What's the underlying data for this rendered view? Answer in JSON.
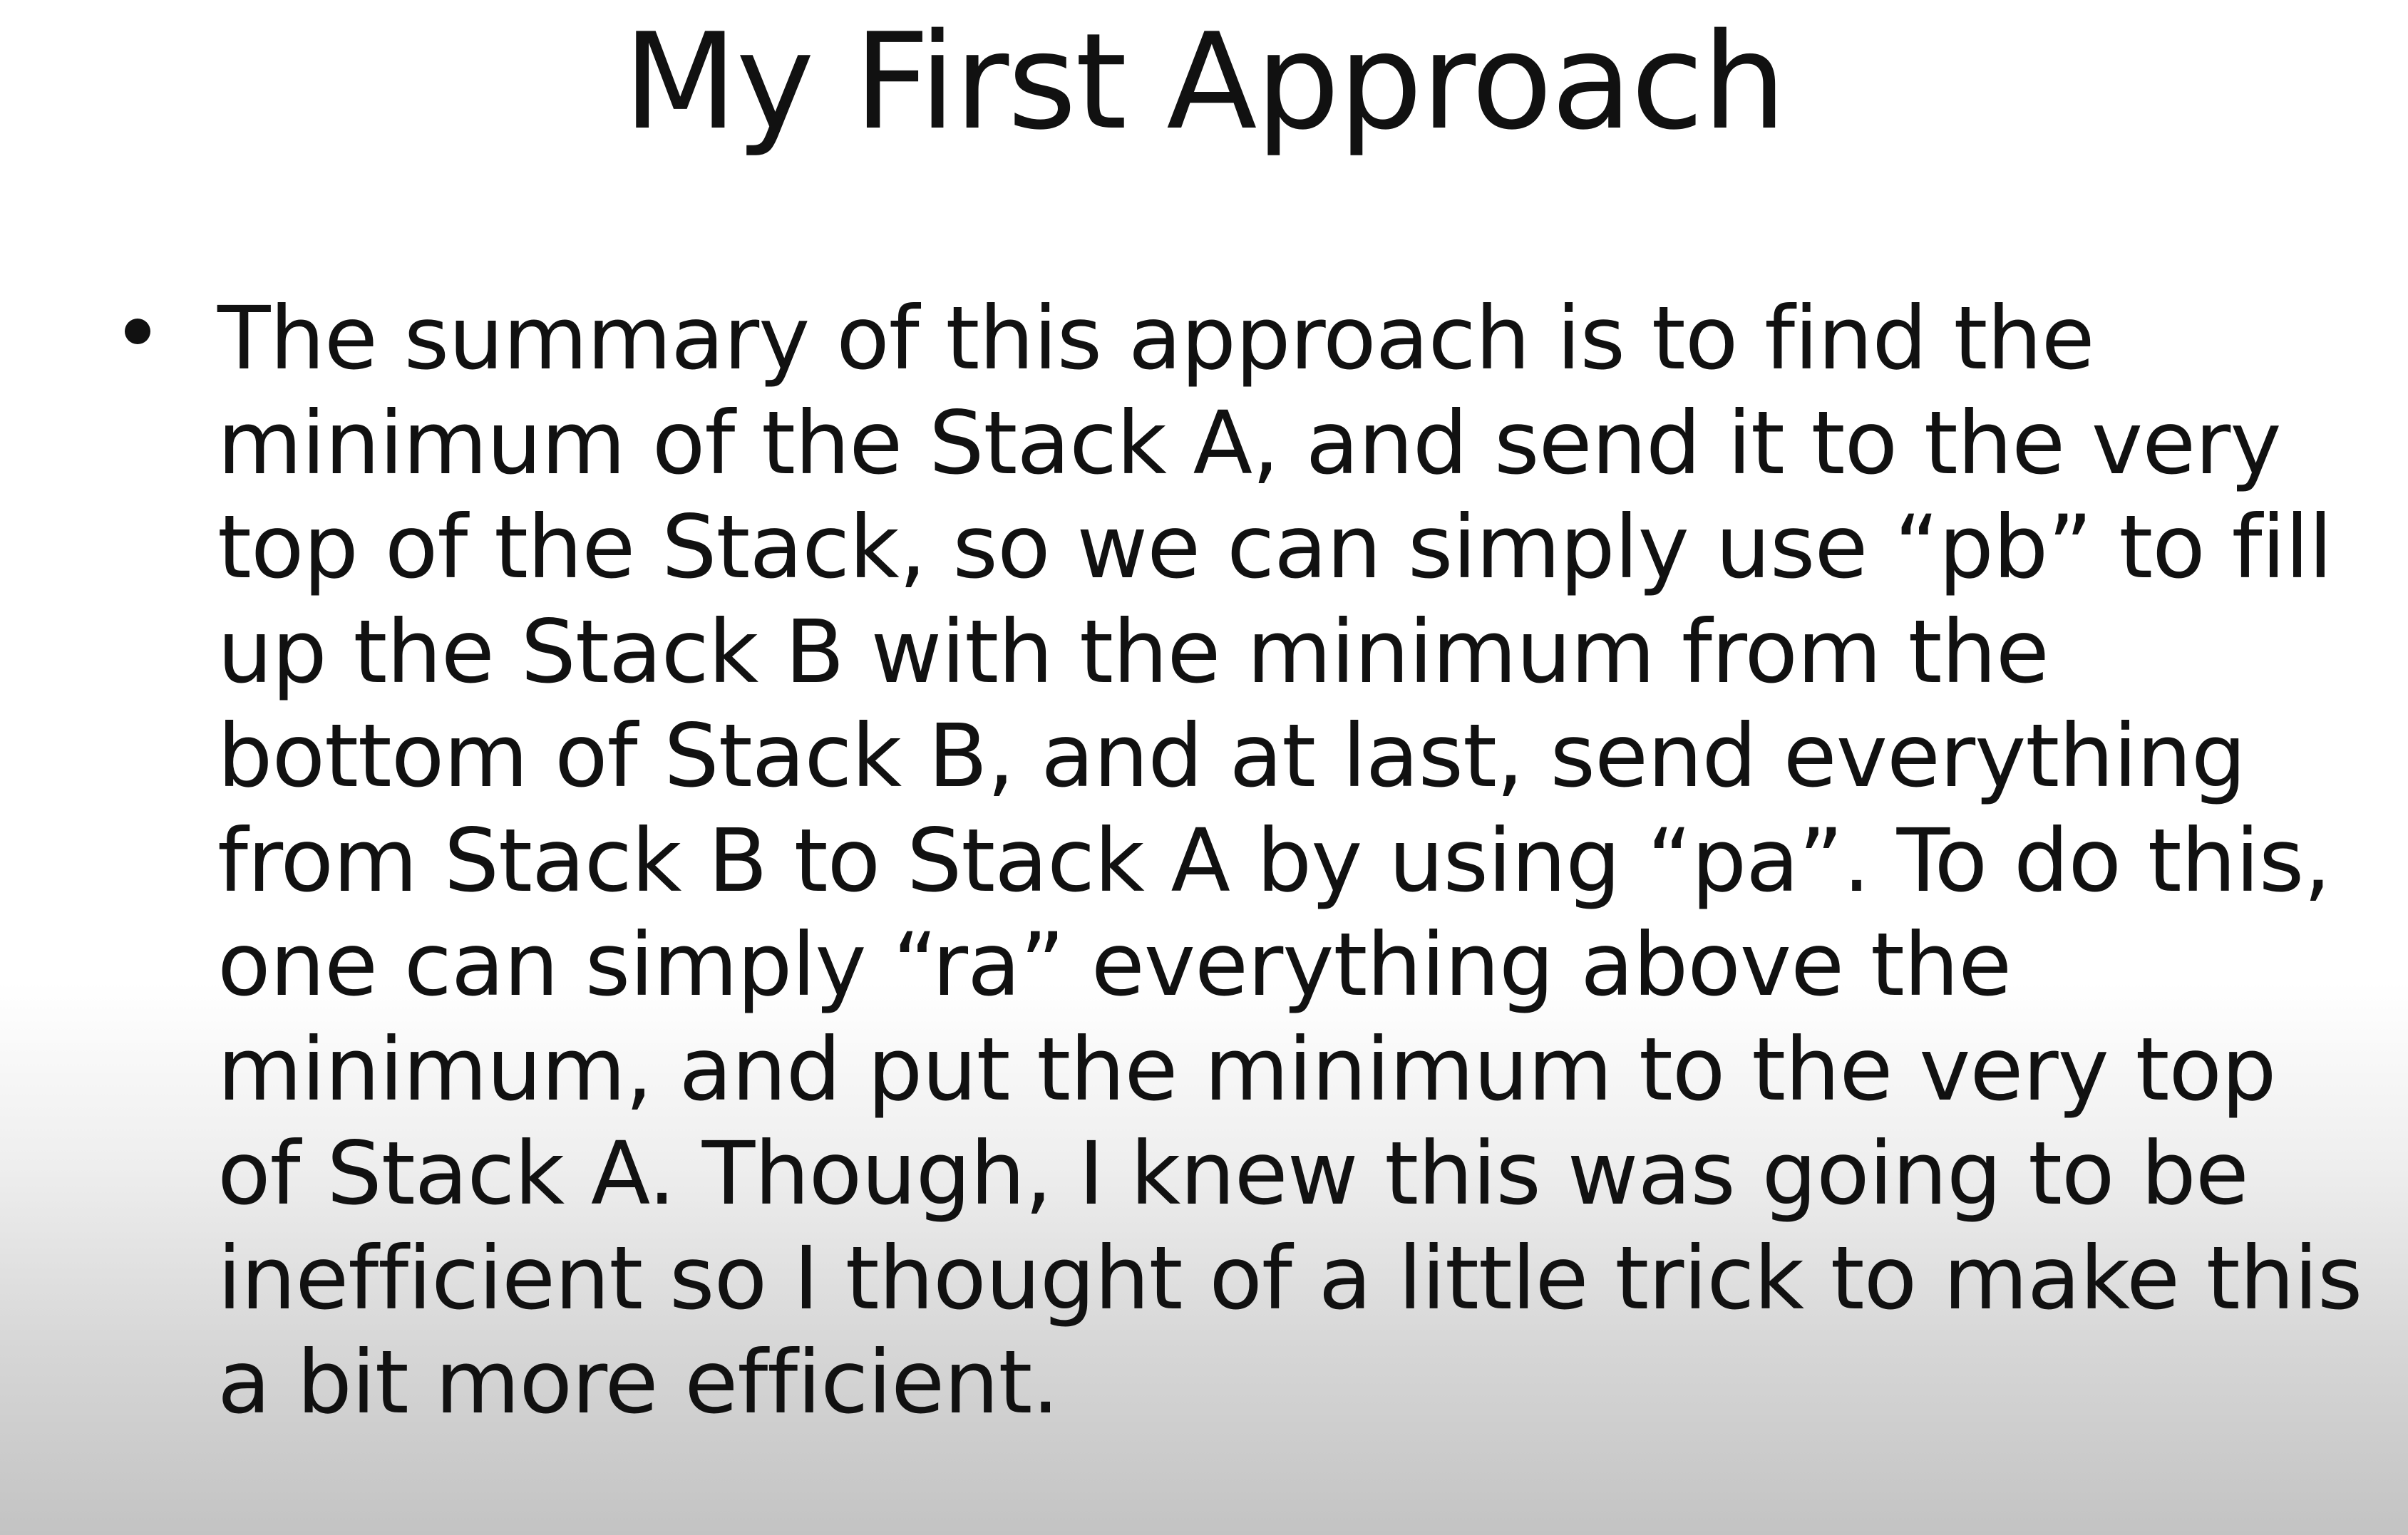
{
  "slide": {
    "title": "My First Approach",
    "bullet": {
      "lines": [
        "The summary of this approach is to find the",
        "minimum of the Stack A, and send it to the very",
        "top of the Stack, so we can simply use “pb” to fill",
        "up the Stack B with the minimum from the",
        "bottom of Stack B, and at last, send everything",
        "from Stack B to Stack A by using “pa”. To do this,",
        "one can simply “ra” everything above the",
        "minimum, and put the minimum to the very top",
        "of Stack A. Though, I knew this was going to be",
        "inefficient so I thought of a little trick to make this",
        "a bit more efficient."
      ]
    }
  }
}
